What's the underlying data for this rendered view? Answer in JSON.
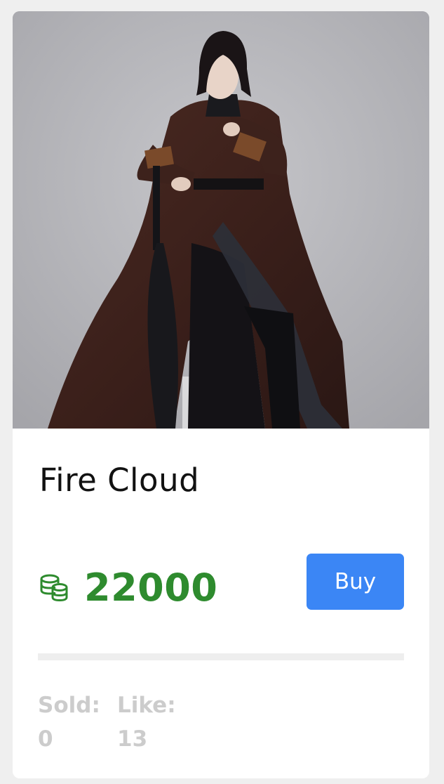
{
  "product": {
    "title": "Fire Cloud",
    "price": "22000",
    "buy_label": "Buy",
    "image_icon": "product-photo-icon",
    "currency_icon": "coins-icon"
  },
  "stats": {
    "sold_label": "Sold:",
    "sold_value": "0",
    "like_label": "Like:",
    "like_value": "13"
  },
  "colors": {
    "price": "#2e8b2e",
    "buy_button": "#3b86f5",
    "page_background": "#efefef",
    "stat_text": "#cccccc"
  }
}
